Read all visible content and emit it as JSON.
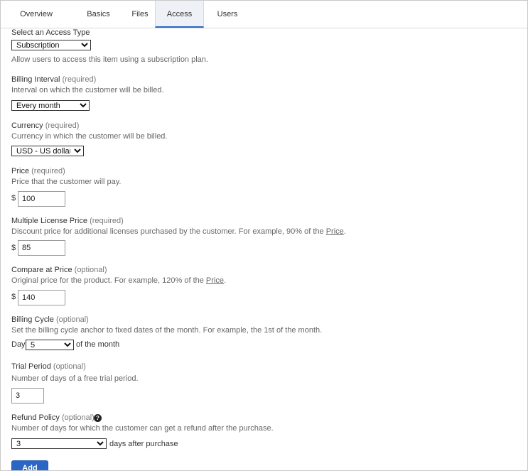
{
  "tabs": [
    {
      "label": "Overview"
    },
    {
      "label": "Basics"
    },
    {
      "label": "Files"
    },
    {
      "label": "Access"
    },
    {
      "label": "Users"
    }
  ],
  "access_type": {
    "label": "Select an Access Type",
    "selected": "Subscription",
    "description": "Allow users to access this item using a subscription plan."
  },
  "billing_interval": {
    "label": "Billing Interval",
    "tag": "(required)",
    "description": "Interval on which the customer will be billed.",
    "selected": "Every month"
  },
  "currency": {
    "label": "Currency",
    "tag": "(required)",
    "description": "Currency in which the customer will be billed.",
    "selected": "USD - US dollar"
  },
  "price": {
    "label": "Price",
    "tag": "(required)",
    "description": "Price that the customer will pay.",
    "symbol": "$",
    "value": "100"
  },
  "multi_license_price": {
    "label": "Multiple License Price",
    "tag": "(required)",
    "description_prefix": "Discount price for additional licenses purchased by the customer. For example, 90% of the ",
    "description_link": "Price",
    "description_suffix": ".",
    "symbol": "$",
    "value": "85"
  },
  "compare_price": {
    "label": "Compare at Price",
    "tag": "(optional)",
    "description_prefix": "Original price for the product. For example, 120% of the ",
    "description_link": "Price",
    "description_suffix": ".",
    "symbol": "$",
    "value": "140"
  },
  "billing_cycle": {
    "label": "Billing Cycle",
    "tag": "(optional)",
    "description": "Set the billing cycle anchor to fixed dates of the month. For example, the 1st of the month.",
    "prefix": "Day",
    "selected": "5",
    "suffix": "of the month"
  },
  "trial_period": {
    "label": "Trial Period",
    "tag": "(optional)",
    "description": "Number of days of a free trial period.",
    "value": "3"
  },
  "refund_policy": {
    "label": "Refund Policy",
    "tag": "(optional)",
    "help_icon": "question-circle-icon",
    "help_glyph": "?",
    "description": "Number of days for which the customer can get a refund after the purchase.",
    "selected": "3",
    "suffix": "days after purchase"
  },
  "add_button": {
    "label": "Add"
  },
  "colors": {
    "accent": "#2a66c4",
    "active_tab_bg": "#eef2f7"
  }
}
